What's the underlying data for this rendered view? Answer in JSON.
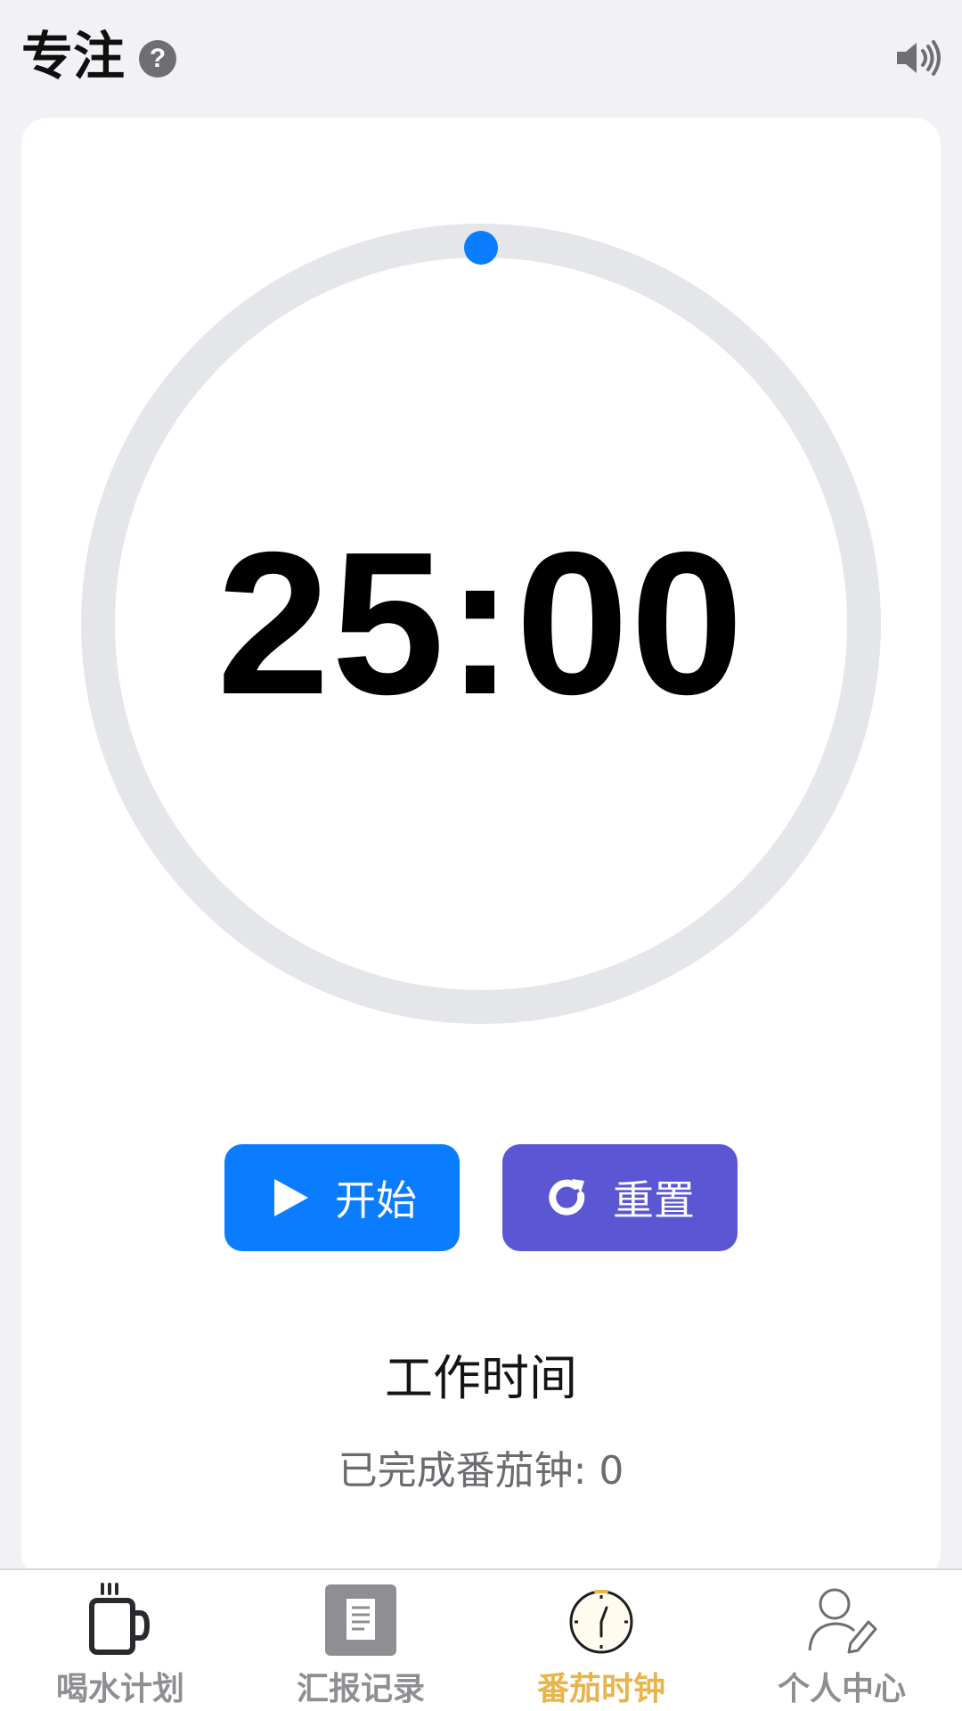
{
  "header": {
    "title": "专注",
    "help_icon": "question-circle-icon",
    "volume_icon": "speaker-volume-icon"
  },
  "timer": {
    "display": "25:00",
    "progress": 0
  },
  "controls": {
    "start_label": "开始",
    "reset_label": "重置"
  },
  "status": {
    "mode": "工作时间",
    "completed": "已完成番茄钟: 0"
  },
  "tabs": [
    {
      "label": "喝水计划",
      "icon": "mug-icon",
      "active": false
    },
    {
      "label": "汇报记录",
      "icon": "document-icon",
      "active": false
    },
    {
      "label": "番茄时钟",
      "icon": "clock-icon",
      "active": true
    },
    {
      "label": "个人中心",
      "icon": "user-edit-icon",
      "active": false
    }
  ],
  "colors": {
    "accent_blue": "#0a7cff",
    "reset_purple": "#5a56d4",
    "ring_track": "#e5e6ea",
    "active_tab": "#e8b44c",
    "inactive_tab": "#8e8e93"
  }
}
